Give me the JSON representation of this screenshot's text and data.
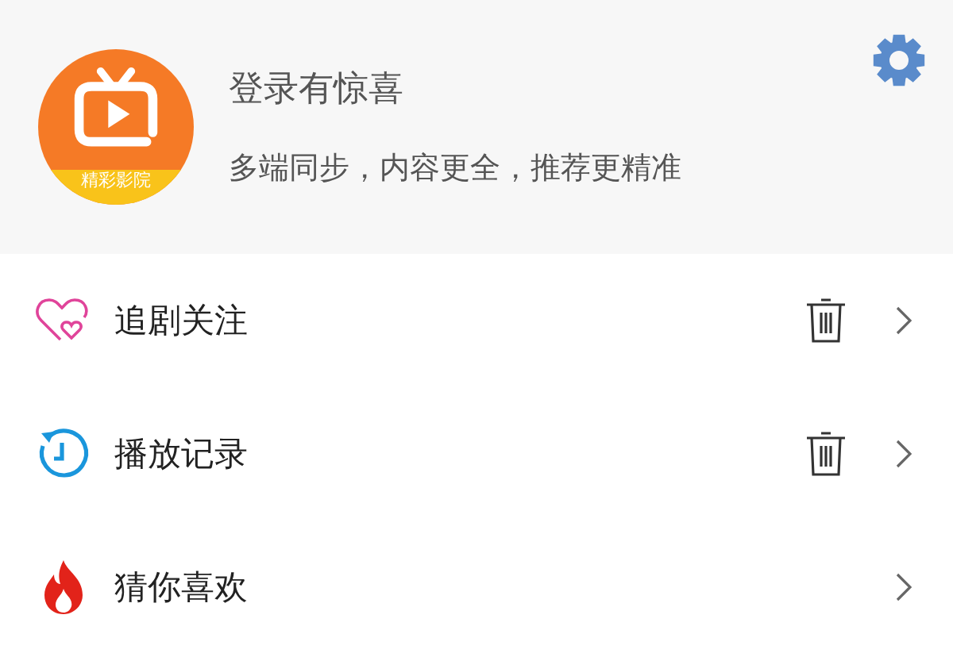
{
  "header": {
    "logo_text": "精彩影院",
    "title": "登录有惊喜",
    "subtitle": "多端同步，内容更全，推荐更精准"
  },
  "menu": [
    {
      "kind": "heart",
      "label": "追剧关注",
      "deletable": true
    },
    {
      "kind": "history",
      "label": "播放记录",
      "deletable": true
    },
    {
      "kind": "fire",
      "label": "猜你喜欢",
      "deletable": false
    }
  ]
}
